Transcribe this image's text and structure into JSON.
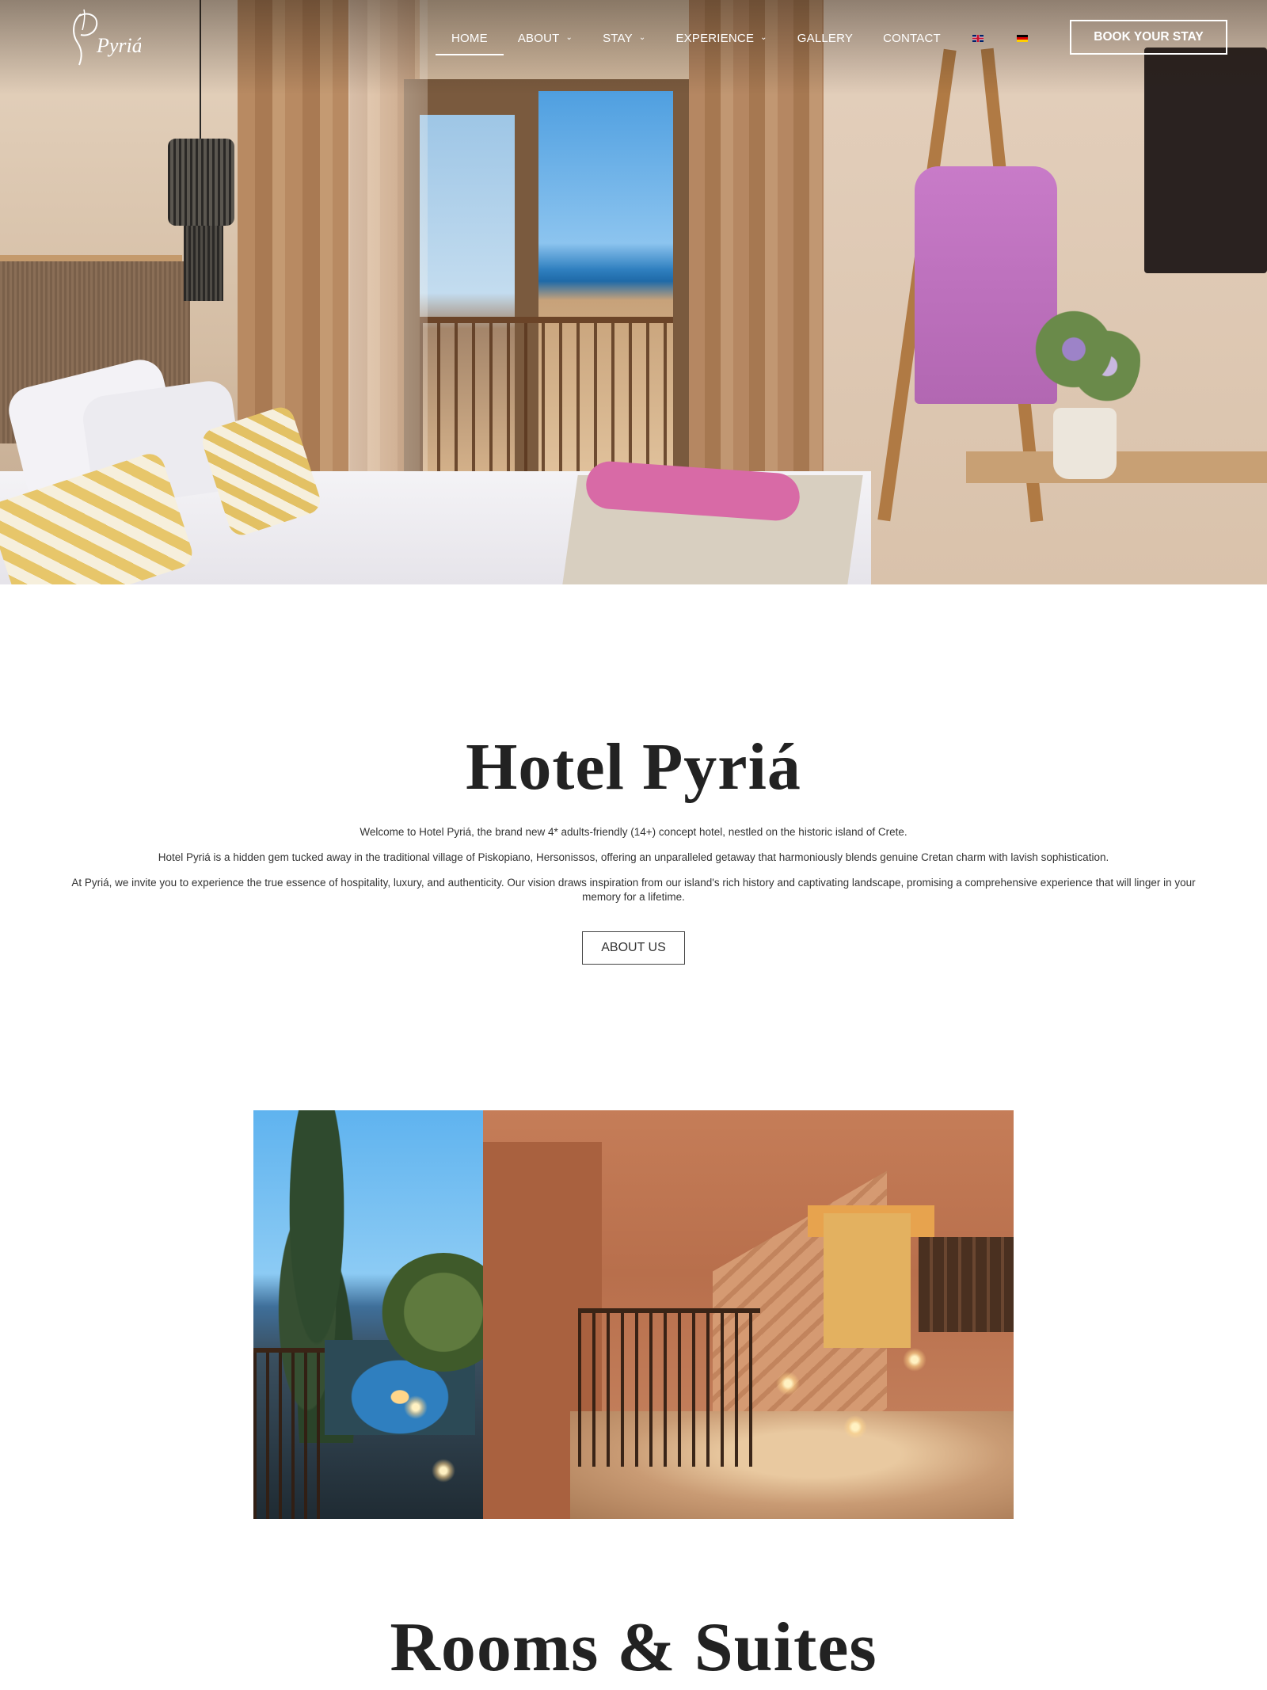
{
  "header": {
    "logo_text": "Pyriá",
    "nav": [
      {
        "label": "HOME",
        "active": true,
        "has_dropdown": false
      },
      {
        "label": "ABOUT",
        "active": false,
        "has_dropdown": true
      },
      {
        "label": "STAY",
        "active": false,
        "has_dropdown": true
      },
      {
        "label": "EXPERIENCE",
        "active": false,
        "has_dropdown": true
      },
      {
        "label": "GALLERY",
        "active": false,
        "has_dropdown": false
      },
      {
        "label": "CONTACT",
        "active": false,
        "has_dropdown": false
      }
    ],
    "languages": [
      "uk-flag-icon",
      "de-flag-icon"
    ],
    "book_label": "BOOK YOUR STAY"
  },
  "hero": {
    "image": "hotel-room-photo"
  },
  "intro": {
    "title": "Hotel Pyriá",
    "paragraphs": [
      "Welcome to Hotel Pyriá, the brand new 4* adults-friendly (14+) concept hotel, nestled on the historic island of Crete.",
      "Hotel Pyriá is a hidden gem tucked away in the traditional village of Piskopiano, Hersonissos, offering an unparalleled getaway that harmoniously blends genuine Cretan charm with lavish sophistication.",
      "At Pyriá, we invite you to experience the true essence of hospitality, luxury, and authenticity. Our vision draws inspiration from our island's rich history and captivating landscape, promising a comprehensive experience that will linger in your memory for a lifetime."
    ],
    "about_label": "ABOUT US"
  },
  "feature_photo": {
    "image": "hotel-exterior-evening-photo"
  },
  "rooms": {
    "title": "Rooms & Suites"
  },
  "colors": {
    "text_dark": "#222222",
    "nav_text": "#ffffff",
    "button_border": "#444444"
  }
}
